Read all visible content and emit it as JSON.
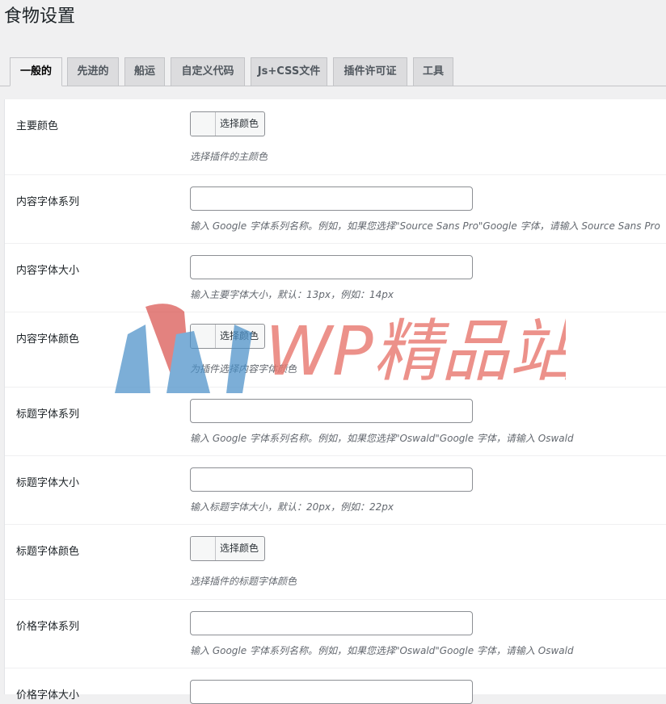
{
  "page": {
    "title": "食物设置"
  },
  "tabs": [
    {
      "label": "一般的",
      "active": true
    },
    {
      "label": "先进的",
      "active": false
    },
    {
      "label": "船运",
      "active": false
    },
    {
      "label": "自定义代码",
      "active": false
    },
    {
      "label": "Js+CSS文件",
      "active": false
    },
    {
      "label": "插件许可证",
      "active": false
    },
    {
      "label": "工具",
      "active": false
    }
  ],
  "fields": [
    {
      "label": "主要颜色",
      "type": "color",
      "button": "选择颜色",
      "value": "",
      "description": "选择插件的主颜色"
    },
    {
      "label": "内容字体系列",
      "type": "text",
      "value": "",
      "description": "输入 Google 字体系列名称。例如，如果您选择\"Source Sans Pro\"Google 字体，请输入 Source Sans Pro"
    },
    {
      "label": "内容字体大小",
      "type": "text",
      "value": "",
      "description": "输入主要字体大小，默认：13px，例如：14px"
    },
    {
      "label": "内容字体颜色",
      "type": "color",
      "button": "选择颜色",
      "value": "",
      "description": "为插件选择内容字体颜色"
    },
    {
      "label": "标题字体系列",
      "type": "text",
      "value": "",
      "description": "输入 Google 字体系列名称。例如，如果您选择\"Oswald\"Google 字体，请输入 Oswald"
    },
    {
      "label": "标题字体大小",
      "type": "text",
      "value": "",
      "description": "输入标题字体大小，默认：20px，例如：22px"
    },
    {
      "label": "标题字体颜色",
      "type": "color",
      "button": "选择颜色",
      "value": "",
      "description": "选择插件的标题字体颜色"
    },
    {
      "label": "价格字体系列",
      "type": "text",
      "value": "",
      "description": "输入 Google 字体系列名称。例如，如果您选择\"Oswald\"Google 字体，请输入 Oswald"
    },
    {
      "label": "价格字体大小",
      "type": "text",
      "value": "",
      "description": ""
    }
  ],
  "watermark": {
    "text": "WP精品站",
    "color_text": "#e8766d",
    "color_red": "#d9534f",
    "color_blue": "#4a90c8"
  }
}
